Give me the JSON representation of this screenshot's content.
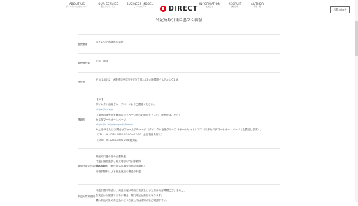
{
  "header": {
    "nav_left": [
      {
        "label": "ABOUT US",
        "sub": "ダイレクトの会社について"
      },
      {
        "label": "OUR SERVICE",
        "sub": "私たちのサービス"
      },
      {
        "label": "BUSINESS MODEL",
        "sub": "ビジネスモデル"
      }
    ],
    "logo_text": "DIRECT",
    "nav_right": [
      {
        "label": "INFORMATION",
        "sub": "お知らせ"
      },
      {
        "label": "RECRUIT",
        "sub": "採用情報"
      },
      {
        "label": "AUTHOR",
        "sub": "著者一覧"
      }
    ],
    "contact_label": "お問い合わせ"
  },
  "page": {
    "title": "特定商取引法に基づく表記"
  },
  "table": {
    "rows": [
      {
        "label": "販売業者",
        "lines": [
          "ダイレクト出版株式会社"
        ]
      },
      {
        "label": "販売責任者",
        "lines": [
          "小川　忠洋"
        ]
      },
      {
        "label": "所在地",
        "lines": [
          "〒541-0052　大阪市中央区安土町2丁目3-13 大阪国際ビルディング13F"
        ]
      },
      {
        "label": "連絡先",
        "lines": [
          "【HP】",
          "ダイレクト出版グループページよりご連絡ください。",
          "https://d-cs.jp",
          "（商品の販売元を確認のうえページからお問合せ下さい。販売元はこちら）",
          "カスタマーサポートページ",
          "https://d-cs.jp/support_form/s",
          "※上記HPまたはお問合せフォーム(TP)ページ（ダイレクト出版グループ サポートサイト）です（以下カスタマーサポートページとも表記します）。",
          "（TEL）06-6268-0850 10:00〜17:00（土日祝日を除く）",
          "（FAX）06-6268-0851 24時間対応"
        ]
      },
      {
        "label": "商品代金以外の必要料金",
        "lines": [
          "商品の代金の他の必要料金",
          "代金引換を選択された場合の代引手数料",
          "購入手数料（銀行振込の場合の振込手数料）",
          "分割手数料による商品追加の場合の料金"
        ]
      },
      {
        "label": "申込の有効期限",
        "lines": [
          "代金引換の場合は、商品お届け時点にお支払いいただければ問題ございません。",
          "お支払いが確認できない場合、発行申込は無効となります。",
          "購入申込み後のお支払いにつきましては承知の後ご確認下さい。"
        ]
      }
    ]
  }
}
